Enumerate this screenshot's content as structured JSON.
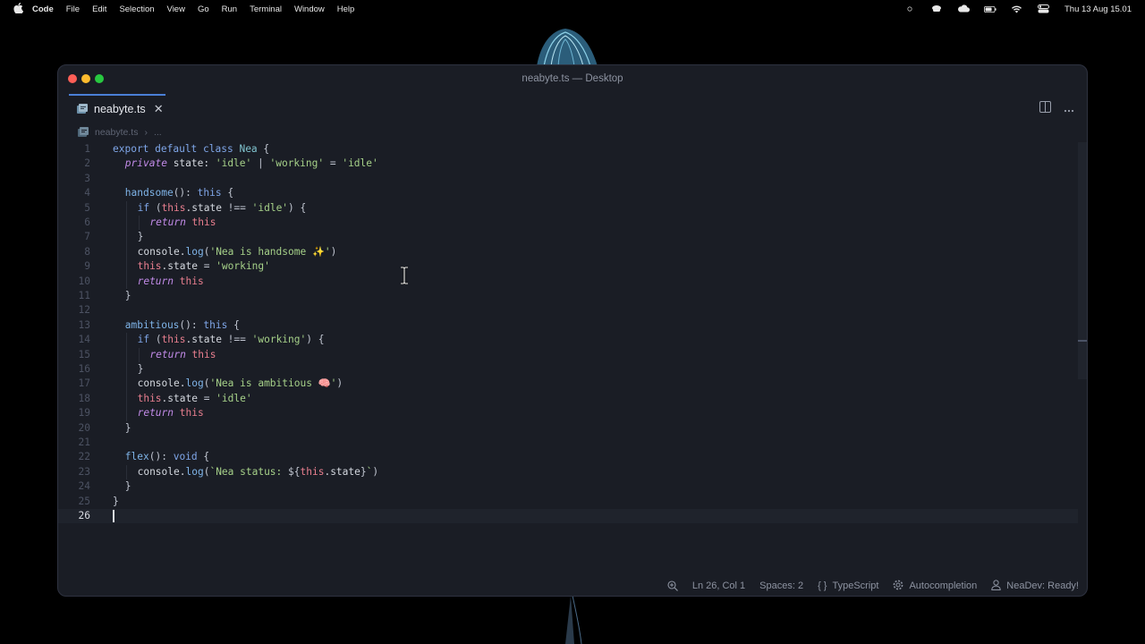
{
  "menubar": {
    "app": "Code",
    "items": [
      "File",
      "Edit",
      "Selection",
      "View",
      "Go",
      "Run",
      "Terminal",
      "Window",
      "Help"
    ],
    "clock": "Thu 13 Aug  15.01"
  },
  "window": {
    "title": "neabyte.ts — Desktop"
  },
  "tab": {
    "label": "neabyte.ts",
    "close": "✕"
  },
  "breadcrumb": {
    "file": "neabyte.ts",
    "separator": "›",
    "more": "..."
  },
  "editor": {
    "cursor_line": 26,
    "lines": [
      {
        "n": "1",
        "indent": 0
      },
      {
        "n": "2",
        "indent": 1
      },
      {
        "n": "3",
        "indent": 0
      },
      {
        "n": "4",
        "indent": 1
      },
      {
        "n": "5",
        "indent": 2
      },
      {
        "n": "6",
        "indent": 3
      },
      {
        "n": "7",
        "indent": 2
      },
      {
        "n": "8",
        "indent": 2
      },
      {
        "n": "9",
        "indent": 2
      },
      {
        "n": "10",
        "indent": 2
      },
      {
        "n": "11",
        "indent": 1
      },
      {
        "n": "12",
        "indent": 0
      },
      {
        "n": "13",
        "indent": 1
      },
      {
        "n": "14",
        "indent": 2
      },
      {
        "n": "15",
        "indent": 3
      },
      {
        "n": "16",
        "indent": 2
      },
      {
        "n": "17",
        "indent": 2
      },
      {
        "n": "18",
        "indent": 2
      },
      {
        "n": "19",
        "indent": 2
      },
      {
        "n": "20",
        "indent": 1
      },
      {
        "n": "21",
        "indent": 0
      },
      {
        "n": "22",
        "indent": 1
      },
      {
        "n": "23",
        "indent": 2
      },
      {
        "n": "24",
        "indent": 1
      },
      {
        "n": "25",
        "indent": 0
      },
      {
        "n": "26",
        "indent": 0
      }
    ],
    "tokens": {
      "l1": [
        [
          "k",
          "export default class "
        ],
        [
          "t",
          "Nea "
        ],
        [
          "p",
          "{"
        ]
      ],
      "l2": [
        [
          "it",
          "private "
        ],
        [
          "v",
          "state: "
        ],
        [
          "s",
          "'idle'"
        ],
        [
          "p",
          " | "
        ],
        [
          "s",
          "'working'"
        ],
        [
          "p",
          " = "
        ],
        [
          "s",
          "'idle'"
        ]
      ],
      "l3": [],
      "l4": [
        [
          "f",
          "handsome"
        ],
        [
          "p",
          "(): "
        ],
        [
          "kc",
          "this "
        ],
        [
          "p",
          "{"
        ]
      ],
      "l5": [
        [
          "k",
          "if "
        ],
        [
          "p",
          "("
        ],
        [
          "th",
          "this"
        ],
        [
          "v",
          ".state "
        ],
        [
          "p",
          "!== "
        ],
        [
          "s",
          "'idle'"
        ],
        [
          "p",
          ") {"
        ]
      ],
      "l6": [
        [
          "it",
          "return "
        ],
        [
          "th",
          "this"
        ]
      ],
      "l7": [
        [
          "p",
          "}"
        ]
      ],
      "l8": [
        [
          "v",
          "console."
        ],
        [
          "f",
          "log"
        ],
        [
          "p",
          "("
        ],
        [
          "s",
          "'Nea is handsome ✨'"
        ],
        [
          "p",
          ")"
        ]
      ],
      "l9": [
        [
          "th",
          "this"
        ],
        [
          "v",
          ".state "
        ],
        [
          "p",
          "= "
        ],
        [
          "s",
          "'working'"
        ]
      ],
      "l10": [
        [
          "it",
          "return "
        ],
        [
          "th",
          "this"
        ]
      ],
      "l11": [
        [
          "p",
          "}"
        ]
      ],
      "l12": [],
      "l13": [
        [
          "f",
          "ambitious"
        ],
        [
          "p",
          "(): "
        ],
        [
          "kc",
          "this "
        ],
        [
          "p",
          "{"
        ]
      ],
      "l14": [
        [
          "k",
          "if "
        ],
        [
          "p",
          "("
        ],
        [
          "th",
          "this"
        ],
        [
          "v",
          ".state "
        ],
        [
          "p",
          "!== "
        ],
        [
          "s",
          "'working'"
        ],
        [
          "p",
          ") {"
        ]
      ],
      "l15": [
        [
          "it",
          "return "
        ],
        [
          "th",
          "this"
        ]
      ],
      "l16": [
        [
          "p",
          "}"
        ]
      ],
      "l17": [
        [
          "v",
          "console."
        ],
        [
          "f",
          "log"
        ],
        [
          "p",
          "("
        ],
        [
          "s",
          "'Nea is ambitious 🧠'"
        ],
        [
          "p",
          ")"
        ]
      ],
      "l18": [
        [
          "th",
          "this"
        ],
        [
          "v",
          ".state "
        ],
        [
          "p",
          "= "
        ],
        [
          "s",
          "'idle'"
        ]
      ],
      "l19": [
        [
          "it",
          "return "
        ],
        [
          "th",
          "this"
        ]
      ],
      "l20": [
        [
          "p",
          "}"
        ]
      ],
      "l21": [],
      "l22": [
        [
          "f",
          "flex"
        ],
        [
          "p",
          "(): "
        ],
        [
          "kc",
          "void "
        ],
        [
          "p",
          "{"
        ]
      ],
      "l23": [
        [
          "v",
          "console."
        ],
        [
          "f",
          "log"
        ],
        [
          "p",
          "("
        ],
        [
          "s",
          "`Nea status: "
        ],
        [
          "p",
          "${"
        ],
        [
          "th",
          "this"
        ],
        [
          "v",
          ".state"
        ],
        [
          "p",
          "}"
        ],
        [
          "s",
          "`"
        ],
        [
          "p",
          ")"
        ]
      ],
      "l24": [
        [
          "p",
          "}"
        ]
      ],
      "l25": [
        [
          "p",
          "}"
        ]
      ],
      "l26": []
    }
  },
  "statusbar": {
    "position": "Ln 26, Col 1",
    "spaces": "Spaces: 2",
    "braces": "{ }",
    "language": "TypeScript",
    "autocompletion": "Autocompletion",
    "neadev": "NeaDev: Ready!"
  },
  "icons": {
    "apple": "apple-logo-icon",
    "file": "typescript-file-icon",
    "split": "split-editor-icon",
    "more": "more-actions-icon",
    "zoom": "zoom-icon",
    "gear": "gear-icon",
    "user": "user-icon"
  },
  "colors": {
    "accent": "#4a7fd6",
    "background": "#1a1d25",
    "keyword": "#7fa6e8",
    "string": "#a6d189",
    "this": "#e97f8f",
    "italic_keyword": "#c28be8"
  }
}
